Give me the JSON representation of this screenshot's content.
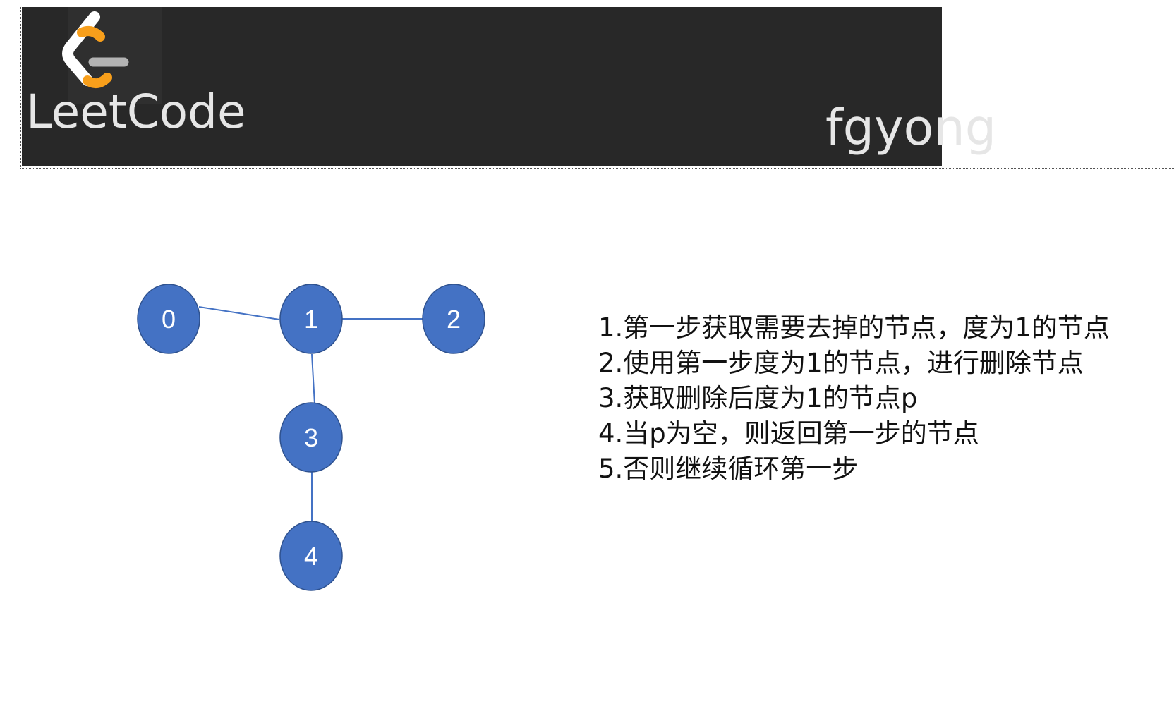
{
  "banner": {
    "brand_name": "LeetCode",
    "author": "fgyong",
    "logo_icon": "leetcode-logo-icon",
    "colors": {
      "background": "#282828",
      "logo_white": "#ffffff",
      "logo_orange": "#f89f1b",
      "logo_gray": "#b3b3b3"
    }
  },
  "graph": {
    "node_color": "#4472c4",
    "edge_color": "#4472c4",
    "nodes": [
      {
        "id": "0",
        "label": "0"
      },
      {
        "id": "1",
        "label": "1"
      },
      {
        "id": "2",
        "label": "2"
      },
      {
        "id": "3",
        "label": "3"
      },
      {
        "id": "4",
        "label": "4"
      }
    ],
    "edges": [
      {
        "from": "0",
        "to": "1"
      },
      {
        "from": "1",
        "to": "2"
      },
      {
        "from": "1",
        "to": "3"
      },
      {
        "from": "3",
        "to": "4"
      }
    ]
  },
  "steps": [
    "1.第一步获取需要去掉的节点，度为1的节点",
    "2.使用第一步度为1的节点，进行删除节点",
    "3.获取删除后度为1的节点p",
    "4.当p为空，则返回第一步的节点",
    "5.否则继续循环第一步"
  ]
}
